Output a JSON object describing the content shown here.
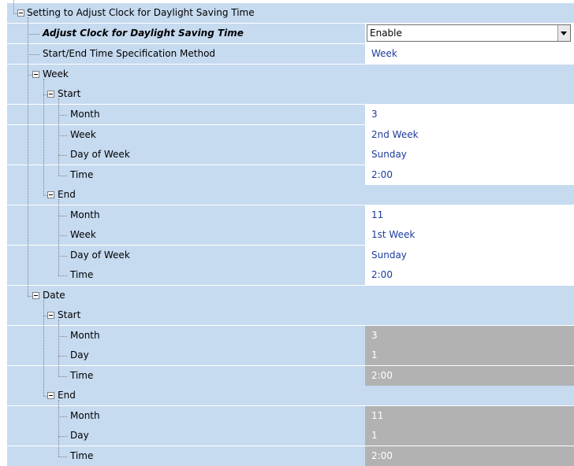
{
  "tree": {
    "root": "Setting to Adjust Clock for Daylight Saving Time",
    "adjust_clock": {
      "label": "Adjust Clock for Daylight Saving Time",
      "value": "Enable"
    },
    "method": {
      "label": "Start/End Time Specification Method",
      "value": "Week"
    },
    "week": {
      "label": "Week",
      "start": {
        "label": "Start",
        "month": {
          "label": "Month",
          "value": "3"
        },
        "week": {
          "label": "Week",
          "value": "2nd Week"
        },
        "day_of_week": {
          "label": "Day of Week",
          "value": "Sunday"
        },
        "time": {
          "label": "Time",
          "value": "2:00"
        }
      },
      "end": {
        "label": "End",
        "month": {
          "label": "Month",
          "value": "11"
        },
        "week": {
          "label": "Week",
          "value": "1st Week"
        },
        "day_of_week": {
          "label": "Day of Week",
          "value": "Sunday"
        },
        "time": {
          "label": "Time",
          "value": "2:00"
        }
      }
    },
    "date": {
      "label": "Date",
      "start": {
        "label": "Start",
        "month": {
          "label": "Month",
          "value": "3"
        },
        "day": {
          "label": "Day",
          "value": "1"
        },
        "time": {
          "label": "Time",
          "value": "2:00"
        }
      },
      "end": {
        "label": "End",
        "month": {
          "label": "Month",
          "value": "11"
        },
        "day": {
          "label": "Day",
          "value": "1"
        },
        "time": {
          "label": "Time",
          "value": "2:00"
        }
      }
    }
  },
  "colors": {
    "row_background": "#c6daf0",
    "editable_value": "#1c3c9c",
    "disabled_value_background": "#b2b2b2"
  }
}
